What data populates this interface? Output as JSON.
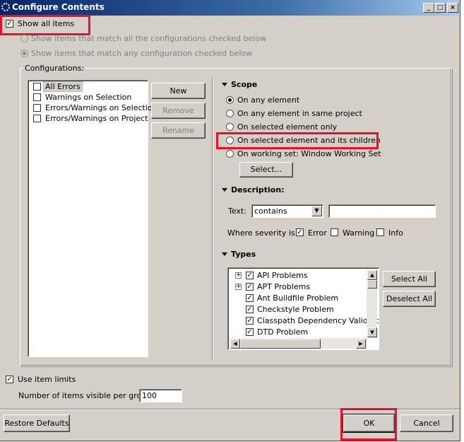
{
  "window": {
    "title": "Configure Contents"
  },
  "show_all_items": {
    "label": "Show all items",
    "checked": true
  },
  "match": {
    "all_label": "Show items that match all the configurations checked below",
    "any_label": "Show items that match any configuration checked below"
  },
  "configurations": {
    "legend": "Configurations:",
    "items": [
      {
        "label": "All Errors",
        "checked": false,
        "selected": true
      },
      {
        "label": "Warnings on Selection",
        "checked": false
      },
      {
        "label": "Errors/Warnings on Selection",
        "checked": false
      },
      {
        "label": "Errors/Warnings on Project",
        "checked": false
      }
    ],
    "new_label": "New",
    "remove_label": "Remove",
    "rename_label": "Rename"
  },
  "scope": {
    "title": "Scope",
    "options": [
      {
        "label": "On any element",
        "selected": true
      },
      {
        "label": "On any element in same project",
        "selected": false
      },
      {
        "label": "On selected element only",
        "selected": false
      },
      {
        "label": "On selected element and its children",
        "selected": false
      },
      {
        "label": "On working set:  Window Working Set",
        "selected": false
      }
    ],
    "select_label": "Select..."
  },
  "description": {
    "title": "Description:",
    "text_label": "Text:",
    "text_mode": "contains",
    "text_value": "",
    "severity_label": "Where severity is:",
    "error_label": "Error",
    "error_checked": true,
    "warning_label": "Warning",
    "warning_checked": false,
    "info_label": "Info",
    "info_checked": false
  },
  "types": {
    "title": "Types",
    "items": [
      {
        "label": "API Problems",
        "expandable": true
      },
      {
        "label": "APT Problems",
        "expandable": true
      },
      {
        "label": "Ant Buildfile Problem",
        "expandable": false
      },
      {
        "label": "Checkstyle Problem",
        "expandable": false
      },
      {
        "label": "Classpath Dependency Validator",
        "expandable": false
      },
      {
        "label": "DTD Problem",
        "expandable": false
      }
    ],
    "select_all_label": "Select All",
    "deselect_all_label": "Deselect All"
  },
  "limits": {
    "use_label": "Use item limits",
    "use_checked": true,
    "count_label": "Number of items visible per group:",
    "count_value": "100"
  },
  "footer": {
    "restore_label": "Restore Defaults",
    "ok_label": "OK",
    "cancel_label": "Cancel"
  },
  "colors": {
    "title_bar": "#0a246a",
    "dialog": "#d4d0c8",
    "highlight_box": "#e8102a"
  }
}
